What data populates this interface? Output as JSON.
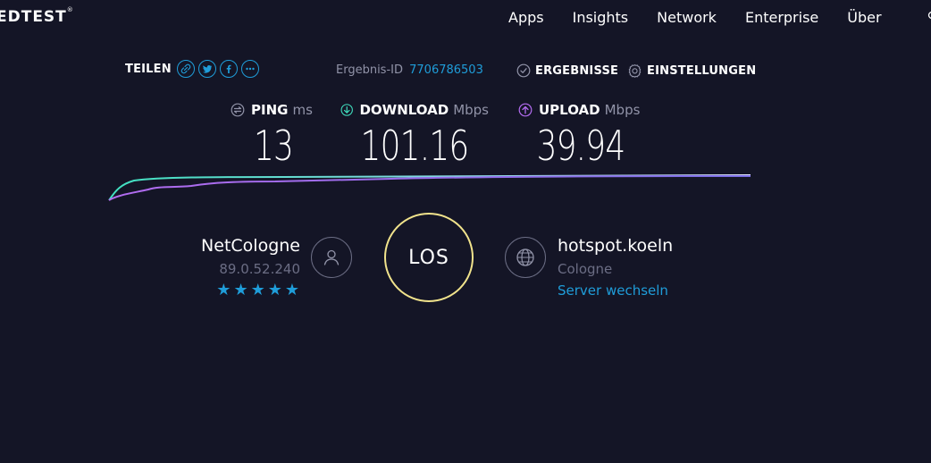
{
  "header": {
    "logo": "EDTEST",
    "logo_mark": "®",
    "nav": [
      "Apps",
      "Insights",
      "Network",
      "Enterprise",
      "Über"
    ]
  },
  "share": {
    "label": "TEILEN",
    "icons": [
      "link-icon",
      "twitter-icon",
      "facebook-icon",
      "more-icon"
    ]
  },
  "result": {
    "label": "Ergebnis-ID",
    "id": "7706786503"
  },
  "links": {
    "results": "ERGEBNISSE",
    "settings": "EINSTELLUNGEN"
  },
  "metrics": {
    "ping": {
      "name": "PING",
      "unit": "ms",
      "value": "13"
    },
    "download": {
      "name": "DOWNLOAD",
      "unit": "Mbps",
      "value": "101.16"
    },
    "upload": {
      "name": "UPLOAD",
      "unit": "Mbps",
      "value": "39.94"
    }
  },
  "isp": {
    "name": "NetCologne",
    "ip": "89.0.52.240",
    "rating_stars": 5
  },
  "go_button": "LOS",
  "server": {
    "name": "hotspot.koeln",
    "city": "Cologne",
    "change": "Server wechseln"
  },
  "colors": {
    "background": "#141526",
    "accent": "#1f9dd9",
    "download_line": "#40e0c0",
    "upload_line": "#9b6cf0",
    "go_ring": "#f1e38c",
    "muted": "#6b6d84"
  }
}
